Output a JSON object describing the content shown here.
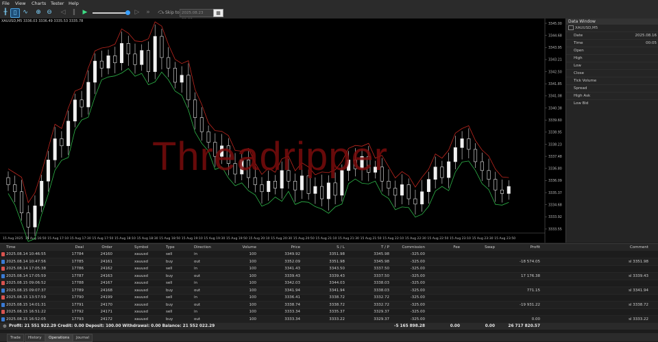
{
  "menu": [
    "File",
    "View",
    "Charts",
    "Tester",
    "Help"
  ],
  "window_title": "",
  "toolbar": {
    "skip_to_label": "Skip to",
    "skip_to_value": "2025.08.23 00:00"
  },
  "chart": {
    "header": "XAUUSD,M5  3336.03 3336.49 3335.53 3335.78",
    "watermark": "Threadripper",
    "price_labels": [
      "3345.00",
      "3344.68",
      "3343.95",
      "3343.21",
      "3342.50",
      "3341.85",
      "3341.08",
      "3340.38",
      "3339.60",
      "3338.95",
      "3338.23",
      "3337.48",
      "3336.80",
      "3336.09",
      "3335.37",
      "3334.68",
      "3333.92",
      "3333.55"
    ],
    "time_labels": [
      "15 Aug 2025",
      "15 Aug 16:50",
      "15 Aug 17:10",
      "15 Aug 17:30",
      "15 Aug 17:50",
      "15 Aug 18:10",
      "15 Aug 18:30",
      "15 Aug 18:50",
      "15 Aug 19:10",
      "15 Aug 19:30",
      "15 Aug 19:50",
      "15 Aug 20:10",
      "15 Aug 20:30",
      "15 Aug 20:50",
      "15 Aug 21:10",
      "15 Aug 21:30",
      "15 Aug 21:50",
      "15 Aug 22:10",
      "15 Aug 22:30",
      "15 Aug 22:50",
      "15 Aug 23:10",
      "15 Aug 23:30",
      "15 Aug 23:50"
    ],
    "closes": [
      3336.0,
      3335.6,
      3334.4,
      3333.6,
      3334.8,
      3336.2,
      3337.4,
      3338.6,
      3338.2,
      3339.6,
      3340.8,
      3340.4,
      3341.8,
      3343.0,
      3342.6,
      3343.3,
      3342.9,
      3344.0,
      3343.4,
      3342.8,
      3343.6,
      3342.4,
      3344.4,
      3343.2,
      3342.6,
      3341.8,
      3342.2,
      3340.8,
      3339.8,
      3339.0,
      3338.4,
      3337.6,
      3338.2,
      3337.2,
      3336.6,
      3337.4,
      3336.4,
      3336.0,
      3335.6,
      3336.2,
      3335.8,
      3336.8,
      3336.2,
      3335.7,
      3336.5,
      3335.5,
      3335.9,
      3335.2,
      3336.1,
      3335.4,
      3336.8,
      3337.4,
      3336.9,
      3337.6,
      3336.7,
      3337.0,
      3336.2,
      3335.8,
      3335.4,
      3336.0,
      3335.2,
      3334.9,
      3335.6,
      3336.3,
      3337.0,
      3336.4,
      3337.3,
      3338.1,
      3338.6,
      3338.0,
      3337.3,
      3336.8,
      3336.3,
      3335.7,
      3335.5,
      3335.9
    ]
  },
  "data_window": {
    "title": "Data Window",
    "symbol": "XAUUSD,M5",
    "rows": [
      {
        "k": "Date",
        "v": "2025.08.16"
      },
      {
        "k": "Time",
        "v": "00:05"
      },
      {
        "k": "Open",
        "v": ""
      },
      {
        "k": "High",
        "v": ""
      },
      {
        "k": "Low",
        "v": ""
      },
      {
        "k": "Close",
        "v": ""
      },
      {
        "k": "Tick Volume",
        "v": ""
      },
      {
        "k": "Spread",
        "v": ""
      },
      {
        "k": "High Ask",
        "v": ""
      },
      {
        "k": "Low Bid",
        "v": ""
      }
    ]
  },
  "table": {
    "headers": [
      "Time",
      "Deal",
      "Order",
      "Symbol",
      "Type",
      "Direction",
      "Volume",
      "Price",
      "S / L",
      "T / P",
      "Commission",
      "Fee",
      "Swap",
      "Profit",
      "Comment"
    ],
    "rows": [
      [
        "2025.08.14 10:46:55",
        "17784",
        "24160",
        "xauusd",
        "sell",
        "in",
        "100",
        "3349.92",
        "3351.98",
        "3345.98",
        "-325.00",
        "",
        "",
        "",
        ""
      ],
      [
        "2025.08.14 10:47:56",
        "17785",
        "24161",
        "xauusd",
        "buy",
        "out",
        "100",
        "3352.09",
        "3351.98",
        "3345.98",
        "-325.00",
        "",
        "",
        "-18 574.05",
        "sl 3351.98"
      ],
      [
        "2025.08.14 17:05:38",
        "17786",
        "24162",
        "xauusd",
        "sell",
        "in",
        "100",
        "3341.43",
        "3343.50",
        "3337.50",
        "-325.00",
        "",
        "",
        "",
        ""
      ],
      [
        "2025.08.14 17:05:59",
        "17787",
        "24163",
        "xauusd",
        "buy",
        "out",
        "100",
        "3339.43",
        "3339.43",
        "3337.50",
        "-325.00",
        "",
        "",
        "17 176.38",
        "sl 3339.43"
      ],
      [
        "2025.08.15 09:06:52",
        "17788",
        "24167",
        "xauusd",
        "sell",
        "in",
        "100",
        "3342.03",
        "3344.03",
        "3338.03",
        "-325.00",
        "",
        "",
        "",
        ""
      ],
      [
        "2025.08.15 09:07:37",
        "17789",
        "24168",
        "xauusd",
        "buy",
        "out",
        "100",
        "3341.94",
        "3341.94",
        "3338.03",
        "-325.00",
        "",
        "",
        "771.15",
        "sl 3341.94"
      ],
      [
        "2025.08.15 13:57:59",
        "17790",
        "24199",
        "xauusd",
        "sell",
        "in",
        "100",
        "3336.41",
        "3338.72",
        "3332.72",
        "-325.00",
        "",
        "",
        "",
        ""
      ],
      [
        "2025.08.15 14:01:31",
        "17791",
        "24170",
        "xauusd",
        "buy",
        "out",
        "100",
        "3338.74",
        "3338.72",
        "3332.72",
        "-325.00",
        "",
        "",
        "-19 931.22",
        "sl 3338.72"
      ],
      [
        "2025.08.15 16:51:22",
        "17792",
        "24171",
        "xauusd",
        "sell",
        "in",
        "100",
        "3333.34",
        "3335.37",
        "3329.37",
        "-325.00",
        "",
        "",
        "",
        ""
      ],
      [
        "2025.08.15 16:52:05",
        "17793",
        "24172",
        "xauusd",
        "buy",
        "out",
        "100",
        "3333.34",
        "3333.22",
        "3329.37",
        "-325.00",
        "",
        "",
        "0.00",
        "sl 3333.22"
      ]
    ],
    "summary": {
      "text": "Profit: 21 551 922.29  Credit: 0.00  Deposit: 100.00  Withdrawal: 0.00  Balance: 21 552 022.29",
      "commission_total": "-5 165 898.28",
      "fee_total": "0.00",
      "swap_total": "0.00",
      "profit_total": "26 717 820.57"
    }
  },
  "tabs": [
    "Trade",
    "History",
    "Operations",
    "Journal"
  ]
}
